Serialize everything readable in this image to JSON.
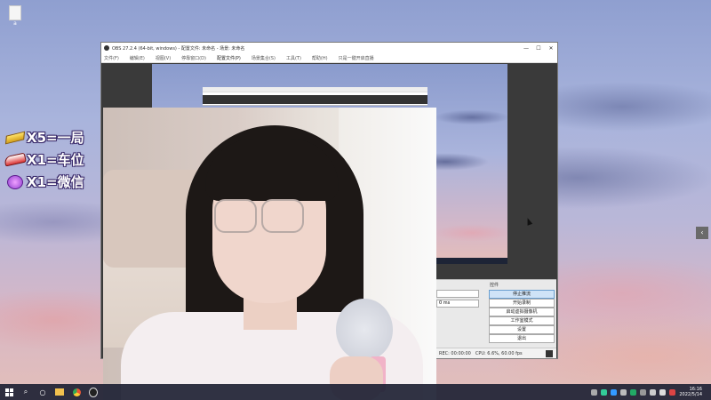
{
  "desktop": {
    "icon_label": "a"
  },
  "overlay": {
    "items": [
      {
        "icon": "gold-bar-icon",
        "text": "X5=一局"
      },
      {
        "icon": "sports-car-icon",
        "text": "X1=车位"
      },
      {
        "icon": "crown-emblem-icon",
        "text": "X1=微信"
      }
    ],
    "text_color": "#ffffff",
    "outline_color": "#3a2a6a"
  },
  "obs": {
    "title": "OBS 27.2.4 (64-bit, windows) - 配置文件: 未命名 - 场景: 未命名",
    "window_controls": [
      "—",
      "☐",
      "✕"
    ],
    "menu": [
      "文件(F)",
      "编辑(E)",
      "视图(V)",
      "停靠窗口(D)",
      "配置文件(P)",
      "场景集合(S)",
      "工具(T)",
      "帮助(H)",
      "只是一键开启直播"
    ],
    "active_menu_index": 4,
    "controls_header": "控件",
    "controls": [
      {
        "label": "停止推流",
        "active": true
      },
      {
        "label": "开始录制",
        "active": false
      },
      {
        "label": "启动虚拟摄像机",
        "active": false
      },
      {
        "label": "工作室模式",
        "active": false
      },
      {
        "label": "设置",
        "active": false
      },
      {
        "label": "退出",
        "active": false
      }
    ],
    "mixer_value": "0 ms",
    "status": {
      "rec": "REC: 00:00:00",
      "cpu": "CPU: 6.6%, 60.00 fps"
    }
  },
  "taskbar": {
    "icons": [
      "windows-logo-icon",
      "search-icon",
      "task-view-icon",
      "file-explorer-icon",
      "chrome-icon",
      "obs-icon"
    ],
    "clock_time": "16:16",
    "clock_date": "2022/5/14"
  }
}
